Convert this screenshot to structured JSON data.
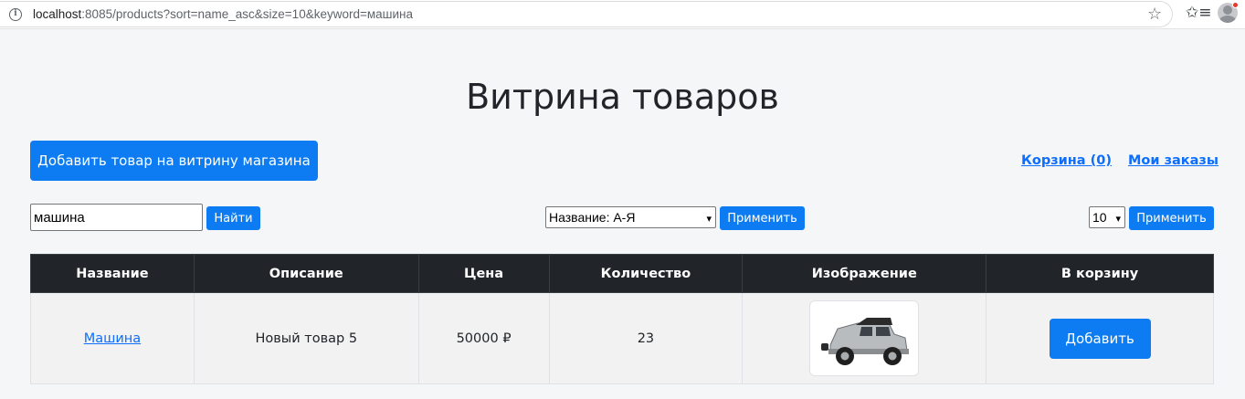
{
  "browser": {
    "url_host": "localhost",
    "url_rest": ":8085/products?sort=name_asc&size=10&keyword=машина",
    "info_icon": "i",
    "star_icon": "☆",
    "favorites_icon": "✩≡"
  },
  "page": {
    "title": "Витрина товаров"
  },
  "actions": {
    "add_product_label": "Добавить товар на витрину магазина",
    "cart_label": "Корзина (0)",
    "orders_label": "Мои заказы"
  },
  "filters": {
    "search_value": "машина",
    "find_label": "Найти",
    "sort_value": "Название: А-Я",
    "sort_apply_label": "Применить",
    "size_value": "10",
    "size_apply_label": "Применить"
  },
  "table": {
    "headers": [
      "Название",
      "Описание",
      "Цена",
      "Количество",
      "Изображение",
      "В корзину"
    ],
    "rows": [
      {
        "name": "Машина",
        "description": "Новый товар 5",
        "price": "50000 ₽",
        "quantity": "23",
        "add_label": "Добавить"
      }
    ]
  },
  "colors": {
    "primary": "#0d7cf2",
    "header_bg": "#212529",
    "link": "#0d6efd"
  }
}
